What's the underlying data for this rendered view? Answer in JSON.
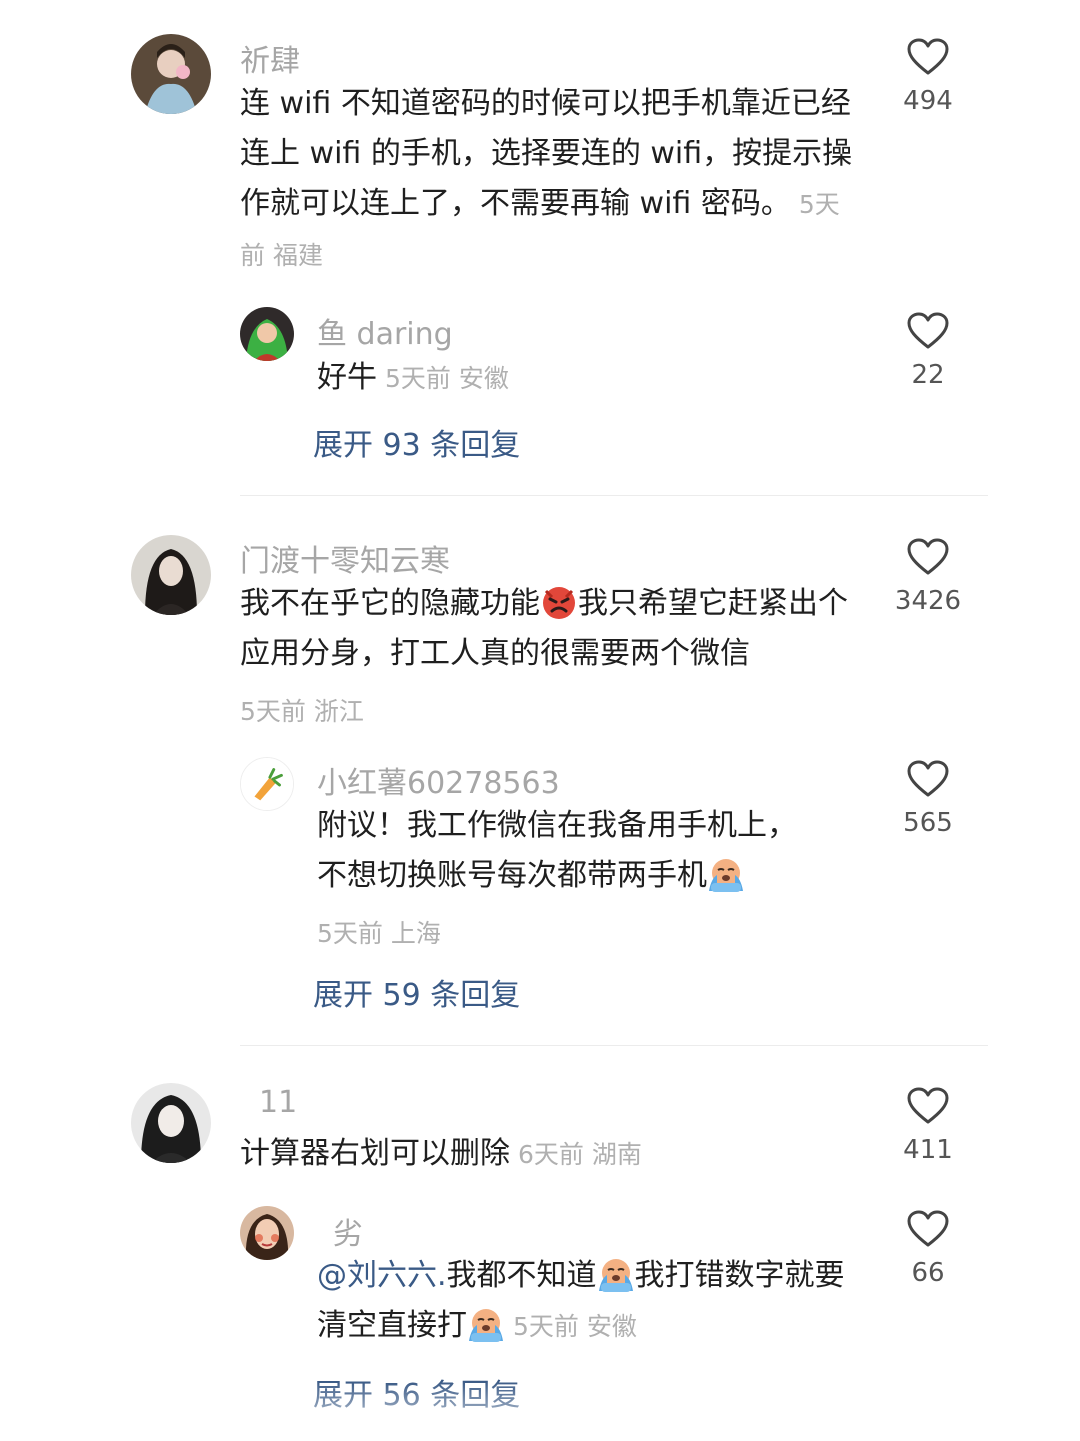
{
  "comments": [
    {
      "username": "祈肆",
      "text": "连 wifi 不知道密码的时候可以把手机靠近已经连上 wifi 的手机，选择要连的 wifi，按提示操作就可以连上了，不需要再输 wifi 密码。",
      "meta": "5天前 福建",
      "likes": "494",
      "reply": {
        "username": "鱼 daring",
        "text": "好牛",
        "meta": "5天前 安徽",
        "likes": "22"
      },
      "expand": "展开 93 条回复"
    },
    {
      "username": "门渡十零知云寒",
      "text_a": "我不在乎它的隐藏功能",
      "text_b": "我只希望它赶紧出个应用分身，打工人真的很需要两个微信",
      "meta": "5天前 浙江",
      "likes": "3426",
      "reply": {
        "username": "小红薯60278563",
        "text": "附议！我工作微信在我备用手机上，不想切换账号每次都带两手机",
        "meta": "5天前 上海",
        "likes": "565"
      },
      "expand": "展开 59 条回复"
    },
    {
      "username": "11",
      "text": "计算器右划可以删除",
      "meta": "6天前 湖南",
      "likes": "411",
      "reply": {
        "username": "劣",
        "mention": "@刘六六.",
        "text_a": "我都不知道",
        "text_b": "我打错数字就要清空直接打",
        "meta": "5天前 安徽",
        "likes": "66"
      },
      "expand": "展开 56 条回复"
    }
  ],
  "colors": {
    "link": "#3a5a86",
    "meta": "#b0b0b0",
    "username": "#a6a6a6"
  },
  "icons": {
    "like": "heart-icon",
    "angry": "angry-face-emoji",
    "crying": "crying-face-emoji"
  }
}
